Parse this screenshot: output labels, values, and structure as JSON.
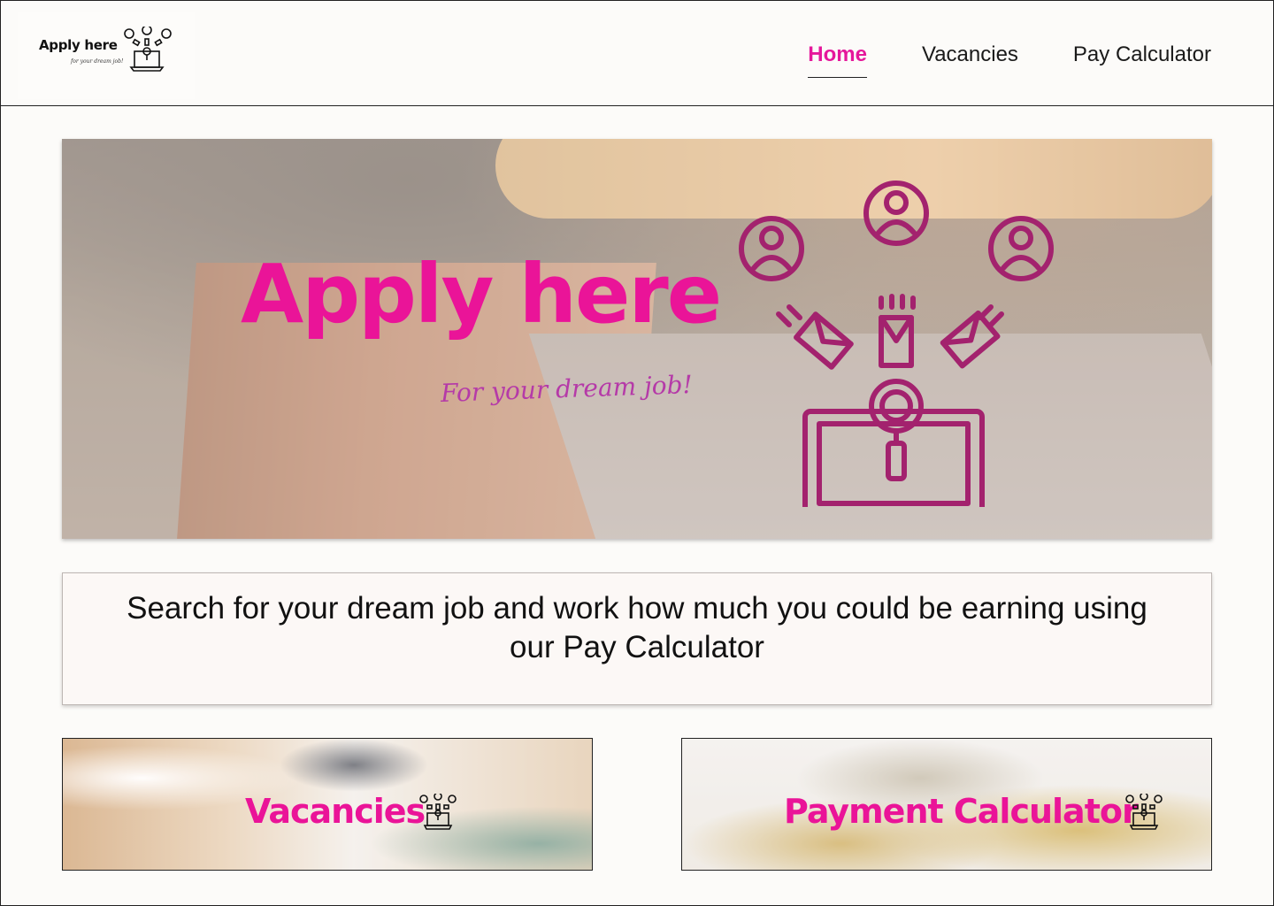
{
  "logo": {
    "title": "Apply here",
    "subtitle": "for your dream job!"
  },
  "nav": {
    "items": [
      {
        "label": "Home",
        "active": true
      },
      {
        "label": "Vacancies",
        "active": false
      },
      {
        "label": "Pay Calculator",
        "active": false
      }
    ]
  },
  "hero": {
    "title": "Apply here",
    "subtitle": "For your dream job!",
    "icon": "job-search-laptop-icon"
  },
  "tagline": {
    "text": "Search for your dream job and work how much you could be earning using our Pay Calculator"
  },
  "cards": [
    {
      "label": "Vacancies",
      "icon": "job-search-laptop-icon"
    },
    {
      "label": "Payment Calculator",
      "icon": "job-search-laptop-icon"
    }
  ],
  "colors": {
    "accent": "#ea1498",
    "hero_icon": "#a3226e",
    "background": "#fcfbf9"
  }
}
